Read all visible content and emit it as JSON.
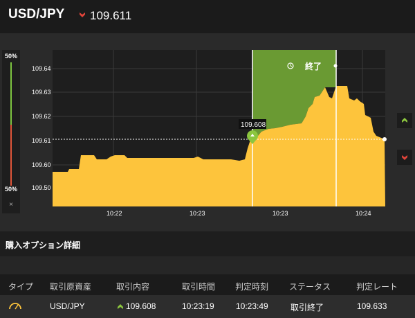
{
  "header": {
    "pair": "USD/JPY",
    "rate": "109.611",
    "rate_direction_icon": "down-arrow-icon",
    "down_color": "#e2443a"
  },
  "gauge": {
    "top_label": "50%",
    "bottom_label": "50%",
    "close_label": "×"
  },
  "chart_data": {
    "type": "area",
    "y_ticks": [
      "109.64",
      "109.63",
      "109.62",
      "109.61",
      "109.60",
      "109.50"
    ],
    "x_ticks": [
      "10:22",
      "10:23",
      "10:23",
      "10:24"
    ],
    "current_rate_label": "109.608",
    "end_label": "終了",
    "series_color": "#fdc43c",
    "profit_zone_color": "#6a9a33"
  },
  "section": {
    "title": "購入オプション詳細"
  },
  "table": {
    "headers": [
      "タイプ",
      "取引原資産",
      "取引内容",
      "取引時間",
      "判定時刻",
      "ステータス",
      "判定レート"
    ],
    "row": {
      "type_icon": "gauge-icon",
      "asset": "USD/JPY",
      "direction_icon": "up-arrow-icon",
      "content": "109.608",
      "trade_time": "10:23:19",
      "judge_time": "10:23:49",
      "status": "取引終了",
      "judge_rate": "109.633"
    }
  }
}
